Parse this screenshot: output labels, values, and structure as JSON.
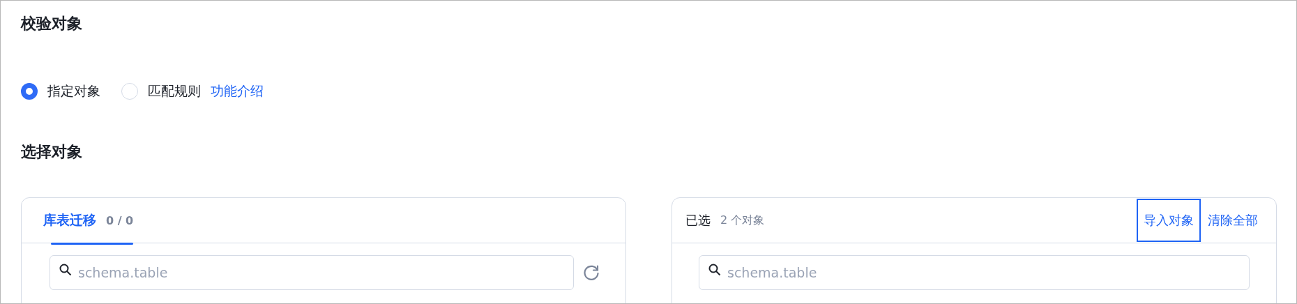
{
  "title": "校验对象",
  "modes": [
    {
      "label": "指定对象",
      "selected": true
    },
    {
      "label": "匹配规则",
      "selected": false
    }
  ],
  "help_link": "功能介绍",
  "select_title": "选择对象",
  "source_panel": {
    "tabs": [
      {
        "label": "库表迁移",
        "count": "0 / 0",
        "selected": true
      }
    ],
    "search": {
      "placeholder": "schema.table"
    }
  },
  "selected_panel": {
    "title": "已选",
    "count": "2 个对象",
    "actions": [
      {
        "label": "导入对象",
        "focused": true
      },
      {
        "label": "清除全部",
        "focused": false
      }
    ],
    "search": {
      "placeholder": "schema.table"
    }
  }
}
